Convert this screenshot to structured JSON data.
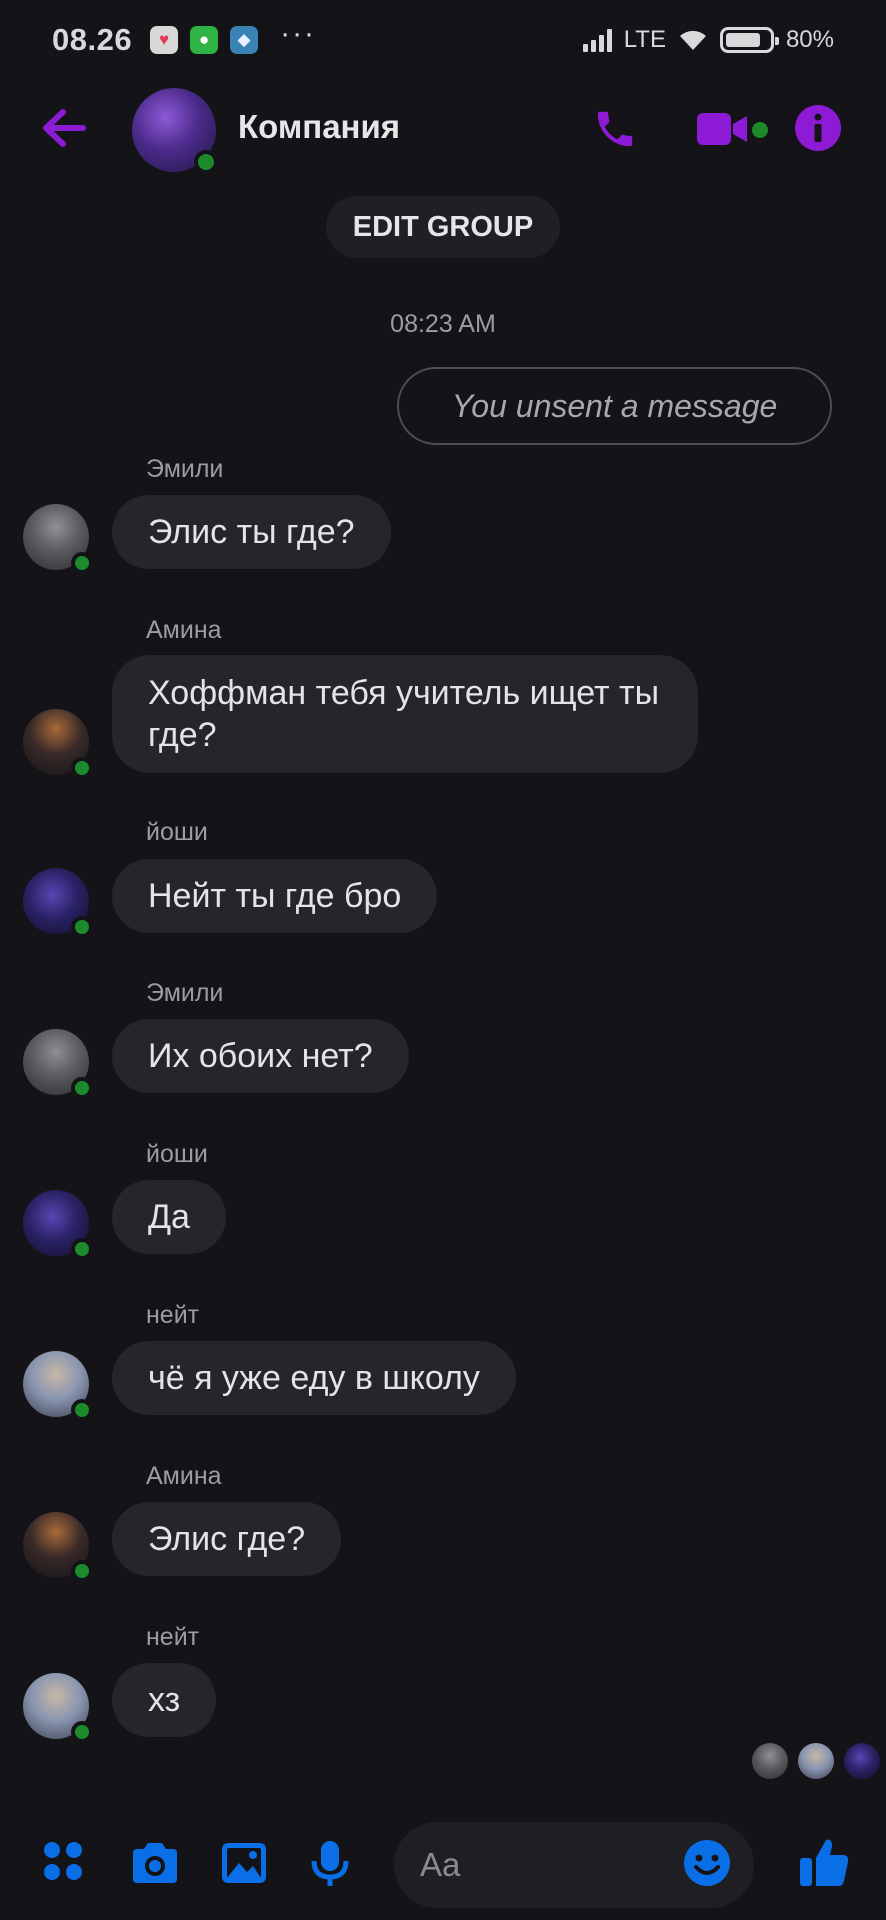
{
  "status_bar": {
    "time": "08.26",
    "network": "LTE",
    "battery": "80%"
  },
  "header": {
    "group_name": "Компания"
  },
  "edit_group_label": "EDIT GROUP",
  "timestamp": "08:23 AM",
  "unsent_notice": "You unsent a message",
  "messages": [
    {
      "sender": "Эмили",
      "text": "Элис ты где?"
    },
    {
      "sender": "Амина",
      "text": "Хоффман тебя учитель ищет ты где?"
    },
    {
      "sender": "йоши",
      "text": "Нейт ты где бро"
    },
    {
      "sender": "Эмили",
      "text": "Их обоих нет?"
    },
    {
      "sender": "йоши",
      "text": "Да"
    },
    {
      "sender": "нейт",
      "text": "чё я уже еду в школу"
    },
    {
      "sender": "Амина",
      "text": "Элис где?"
    },
    {
      "sender": "нейт",
      "text": "хз"
    }
  ],
  "composer": {
    "placeholder": "Aa"
  },
  "colors": {
    "accent_purple": "#8d1bd6",
    "accent_blue": "#0a6fe6",
    "online_green": "#1d8b2c",
    "bubble_bg": "#26252b",
    "background": "#141317"
  },
  "icons": {
    "header": [
      "back-arrow-icon",
      "phone-icon",
      "video-camera-icon",
      "info-icon"
    ],
    "composer": [
      "menu-dots-icon",
      "camera-icon",
      "image-icon",
      "microphone-icon",
      "emoji-icon",
      "thumbs-up-icon"
    ]
  }
}
